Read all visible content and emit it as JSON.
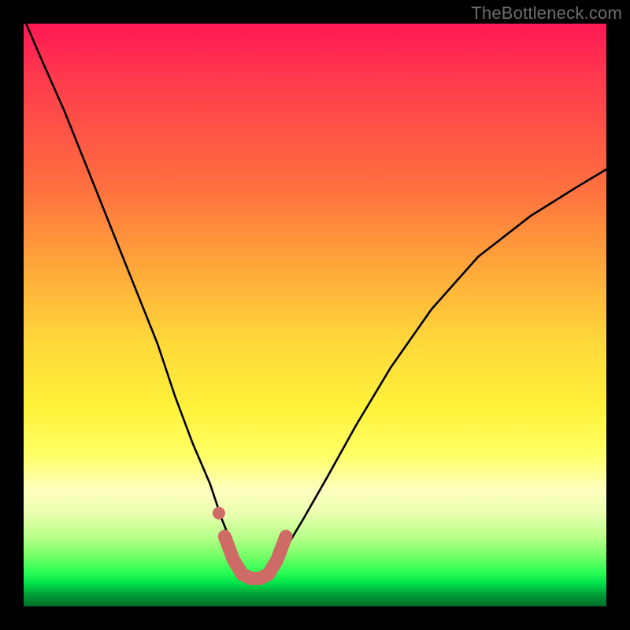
{
  "watermark": "TheBottleneck.com",
  "colors": {
    "frame": "#000000",
    "curve": "#000000",
    "marker": "#cf6b66",
    "watermark": "#6c6c6c"
  },
  "chart_data": {
    "type": "line",
    "title": "",
    "xlabel": "",
    "ylabel": "",
    "xlim": [
      0,
      1
    ],
    "ylim": [
      0,
      100
    ],
    "grid": false,
    "note": "No axis ticks or labels are rendered; values below are estimated from pixel positions relative to plot area (x normalized 0-1, y as percentage 0=bottom 100=top).",
    "series": [
      {
        "name": "bottleneck-curve",
        "x": [
          0.0,
          0.03,
          0.07,
          0.11,
          0.15,
          0.19,
          0.23,
          0.26,
          0.29,
          0.32,
          0.34,
          0.36,
          0.37,
          0.385,
          0.4,
          0.415,
          0.43,
          0.45,
          0.48,
          0.52,
          0.57,
          0.63,
          0.7,
          0.78,
          0.87,
          0.95,
          1.0
        ],
        "y": [
          101,
          94,
          85,
          75,
          65,
          55,
          45,
          36,
          28,
          21,
          15,
          10,
          7,
          5,
          4.5,
          5,
          7,
          10,
          15,
          22,
          31,
          41,
          51,
          60,
          67,
          72,
          75
        ]
      }
    ],
    "markers": {
      "name": "highlight-band",
      "note": "Salmon thick stroke segment near curve minimum plus single dot just above left end.",
      "segment_x": [
        0.345,
        0.36,
        0.375,
        0.39,
        0.405,
        0.42,
        0.435,
        0.45
      ],
      "segment_y": [
        12,
        8,
        5.5,
        4.8,
        4.8,
        5.5,
        8,
        12
      ],
      "dot": {
        "x": 0.335,
        "y": 16
      }
    }
  }
}
